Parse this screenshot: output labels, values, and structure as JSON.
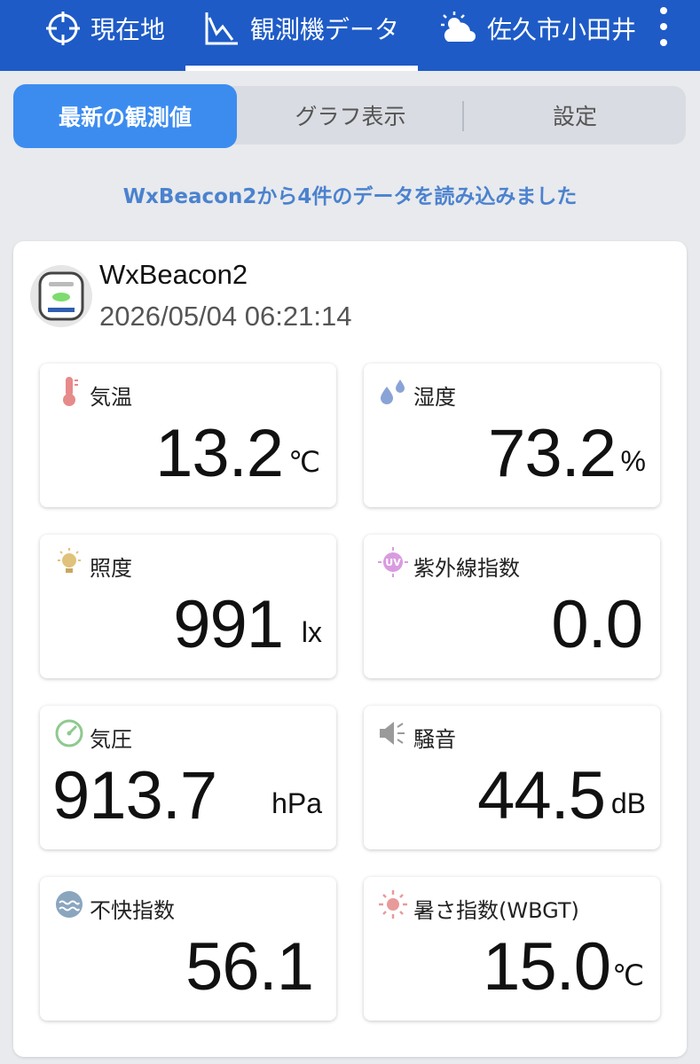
{
  "header": {
    "tabs": [
      {
        "label": "現在地",
        "icon": "crosshair-icon"
      },
      {
        "label": "観測機データ",
        "icon": "chart-icon"
      },
      {
        "label": "佐久市小田井",
        "icon": "partly-cloudy-icon"
      }
    ],
    "active_tab": 1,
    "menu_icon": "more-vert-icon"
  },
  "segments": [
    {
      "label": "最新の観測値",
      "active": true
    },
    {
      "label": "グラフ表示",
      "active": false
    },
    {
      "label": "設定",
      "active": false
    }
  ],
  "status_message": "WxBeacon2から4件のデータを読み込みました",
  "device": {
    "name": "WxBeacon2",
    "timestamp": "2026/05/04 06:21:14"
  },
  "readings": [
    {
      "label": "気温",
      "value": "13.2",
      "unit": "℃",
      "icon": "thermometer-icon",
      "color": "#e68a8a"
    },
    {
      "label": "湿度",
      "value": "73.2",
      "unit": "%",
      "icon": "droplets-icon",
      "color": "#8aa3d6"
    },
    {
      "label": "照度",
      "value": "991",
      "unit": "lx",
      "icon": "lightbulb-icon",
      "color": "#e0c27a"
    },
    {
      "label": "紫外線指数",
      "value": "0.0",
      "unit": "",
      "icon": "uv-icon",
      "color": "#d99be0"
    },
    {
      "label": "気圧",
      "value": "913.7",
      "unit": "hPa",
      "icon": "gauge-icon",
      "color": "#8fc98f"
    },
    {
      "label": "騒音",
      "value": "44.5",
      "unit": "dB",
      "icon": "megaphone-icon",
      "color": "#9a9a9a"
    },
    {
      "label": "不快指数",
      "value": "56.1",
      "unit": "",
      "icon": "discomfort-icon",
      "color": "#8aa6bf"
    },
    {
      "label": "暑さ指数(WBGT)",
      "value": "15.0",
      "unit": "℃",
      "icon": "sun-icon",
      "color": "#e89a9a"
    }
  ],
  "colors": {
    "header": "#1e5bc6",
    "accent": "#3c8cf0",
    "status_text": "#4b82cf"
  }
}
